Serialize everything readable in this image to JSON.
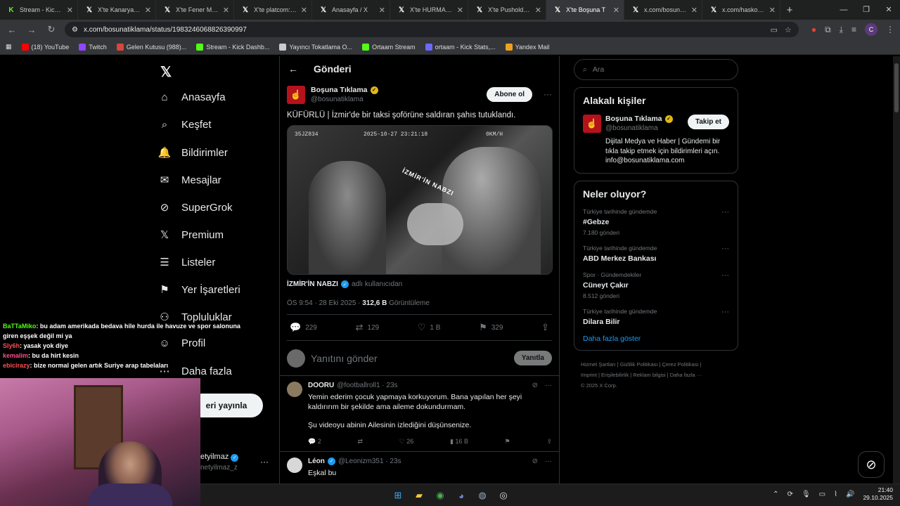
{
  "browser": {
    "tabs": [
      {
        "icon": "kick-icon",
        "title": "Stream - Kick Dash"
      },
      {
        "icon": "x-icon",
        "title": "X'te Kanarya Spor"
      },
      {
        "icon": "x-icon",
        "title": "X'te Fener Markaj"
      },
      {
        "icon": "x-icon",
        "title": "X'te platcom: \"Ki"
      },
      {
        "icon": "x-icon",
        "title": "Anasayfa / X"
      },
      {
        "icon": "x-icon",
        "title": "X'te HURMA: \"Bu"
      },
      {
        "icon": "x-icon",
        "title": "X'te Pusholder: \"S"
      },
      {
        "icon": "x-icon",
        "title": "X'te Boşuna T",
        "active": true
      },
      {
        "icon": "x-icon",
        "title": "x.com/bosunatikl"
      },
      {
        "icon": "x-icon",
        "title": "x.com/haskologlu"
      }
    ],
    "url": "x.com/bosunatiklama/status/1983246068826390997",
    "profile_initial": "C",
    "bookmarks": [
      {
        "label": "(18) YouTube",
        "color": "#ff0000"
      },
      {
        "label": "Twitch",
        "color": "#9146ff"
      },
      {
        "label": "Gelen Kutusu (988)...",
        "color": "#d9463b"
      },
      {
        "label": "Stream - Kick Dashb...",
        "color": "#53fc18"
      },
      {
        "label": "Yayıncı Tokatlama O...",
        "color": "#cccccc"
      },
      {
        "label": "Ortaam Stream",
        "color": "#53fc18"
      },
      {
        "label": "ortaam - Kick Stats,...",
        "color": "#6a6aff"
      },
      {
        "label": "Yandex Mail",
        "color": "#f0a020"
      }
    ]
  },
  "nav": {
    "items": [
      {
        "icon": "home-icon",
        "label": "Anasayfa"
      },
      {
        "icon": "search-icon",
        "label": "Keşfet"
      },
      {
        "icon": "bell-icon",
        "label": "Bildirimler"
      },
      {
        "icon": "mail-icon",
        "label": "Mesajlar"
      },
      {
        "icon": "grok-icon",
        "label": "SuperGrok"
      },
      {
        "icon": "x-icon",
        "label": "Premium"
      },
      {
        "icon": "list-icon",
        "label": "Listeler"
      },
      {
        "icon": "bookmark-icon",
        "label": "Yer İşaretleri"
      },
      {
        "icon": "community-icon",
        "label": "Topluluklar"
      },
      {
        "icon": "profile-icon",
        "label": "Profil"
      },
      {
        "icon": "more-icon",
        "label": "Daha fazla"
      }
    ],
    "post_button": "eri yayınla",
    "account_name": "etyilmaz",
    "account_handle": "netyilmaz_z"
  },
  "main": {
    "header": "Gönderi",
    "tweet": {
      "name": "Boşuna Tıklama",
      "handle": "@bosunatiklama",
      "subscribe": "Abone ol",
      "text": "KÜFÜRLÜ | İzmir'de bir taksi şoförüne saldıran şahıs tutuklandı.",
      "video_plate": "35JZ834",
      "video_time": "2025-10-27 23:21:18",
      "video_speed": "0KM/H",
      "video_watermark": "İZMİR'İN NABZI",
      "source_name": "İZMİR'İN NABZI",
      "source_suffix": "adlı kullanıcıdan",
      "time": "ÖS 9:54 · 28 Eki 2025 ·",
      "views": "312,6 B",
      "views_label": "Görüntüleme",
      "replies": "229",
      "reposts": "129",
      "likes": "1 B",
      "bookmarks": "329"
    },
    "reply_box": {
      "placeholder": "Yanıtını gönder",
      "button": "Yanıtla"
    },
    "replies": [
      {
        "name": "DOORU",
        "handle": "@footballroll1 · 23s",
        "text1": "Yemin ederim çocuk yapmaya korkuyorum. Bana yapılan her şeyi kaldırırım bir şekilde ama aileme dokundurmam.",
        "text2": "Şu videoyu abinin Ailesinin izlediğini düşünsenize.",
        "replies": "2",
        "likes": "26",
        "views": "16 B"
      },
      {
        "name": "Léon",
        "handle": "@Leonizm351 · 23s",
        "text1": "Eşkal bu"
      }
    ]
  },
  "right": {
    "search_placeholder": "Ara",
    "relevant_title": "Alakalı kişiler",
    "person": {
      "name": "Boşuna Tıklama",
      "handle": "@bosunatiklama",
      "follow": "Takip et",
      "bio": "Dijital Medya ve Haber | Gündemi bir tıkla takip etmek için bildirimleri açın. info@bosunatiklama.com"
    },
    "trends_title": "Neler oluyor?",
    "trends": [
      {
        "context": "Türkiye tarihinde gündemde",
        "name": "#Gebze",
        "count": "7.180 gönderi"
      },
      {
        "context": "Türkiye tarihinde gündemde",
        "name": "ABD Merkez Bankası",
        "count": ""
      },
      {
        "context": "Spor · Gündemdekiler",
        "name": "Cüneyt Çakır",
        "count": "8.512 gönderi"
      },
      {
        "context": "Türkiye tarihinde gündemde",
        "name": "Dilara Bilir",
        "count": ""
      }
    ],
    "show_more": "Daha fazla göster",
    "footer_line1": "Hizmet Şartları | Gizlilik Politikası | Çerez Politikası |",
    "footer_line2": "Imprint | Erişilebilirlik | Reklam bilgisi | Daha fazla ···",
    "footer_line3": "© 2025 X Corp."
  },
  "chat": [
    {
      "user": "BaTTaMiko",
      "color": "#53fc18",
      "text": ": bu adam amerikada bedava hile hurda ile havuze ve spor salonuna giren eşşek değil mi ya"
    },
    {
      "user": "Sly6h",
      "color": "#ff4d4d",
      "text": ": yasak yok diye"
    },
    {
      "user": "kemalim",
      "color": "#ff4d8a",
      "text": ": bu da hirt kesin"
    },
    {
      "user": "ebicirazy",
      "color": "#ff5050",
      "text": ": bize normal gelen artık Suriye arap tabelaları"
    }
  ],
  "taskbar": {
    "time": "21:40",
    "date": "29.10.2025"
  }
}
